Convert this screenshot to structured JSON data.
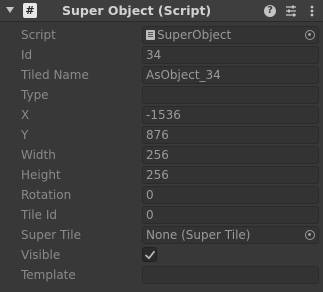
{
  "header": {
    "title": "Super Object (Script)",
    "script_glyph": "#",
    "help_glyph": "?",
    "icons": {
      "foldout": "chevron-down-icon",
      "enable": "checkbox-icon",
      "script": "script-icon",
      "help": "help-icon",
      "preset": "sliders-icon",
      "menu": "kebab-menu-icon"
    }
  },
  "fields": {
    "script": {
      "label": "Script",
      "value": "SuperObject"
    },
    "id": {
      "label": "Id",
      "value": "34"
    },
    "tiled_name": {
      "label": "Tiled Name",
      "value": "AsObject_34"
    },
    "type": {
      "label": "Type",
      "value": ""
    },
    "x": {
      "label": "X",
      "value": "-1536"
    },
    "y": {
      "label": "Y",
      "value": "876"
    },
    "width": {
      "label": "Width",
      "value": "256"
    },
    "height": {
      "label": "Height",
      "value": "256"
    },
    "rotation": {
      "label": "Rotation",
      "value": "0"
    },
    "tile_id": {
      "label": "Tile Id",
      "value": "0"
    },
    "super_tile": {
      "label": "Super Tile",
      "value": "None (Super Tile)"
    },
    "visible": {
      "label": "Visible",
      "checked": true
    },
    "template": {
      "label": "Template",
      "value": ""
    }
  }
}
